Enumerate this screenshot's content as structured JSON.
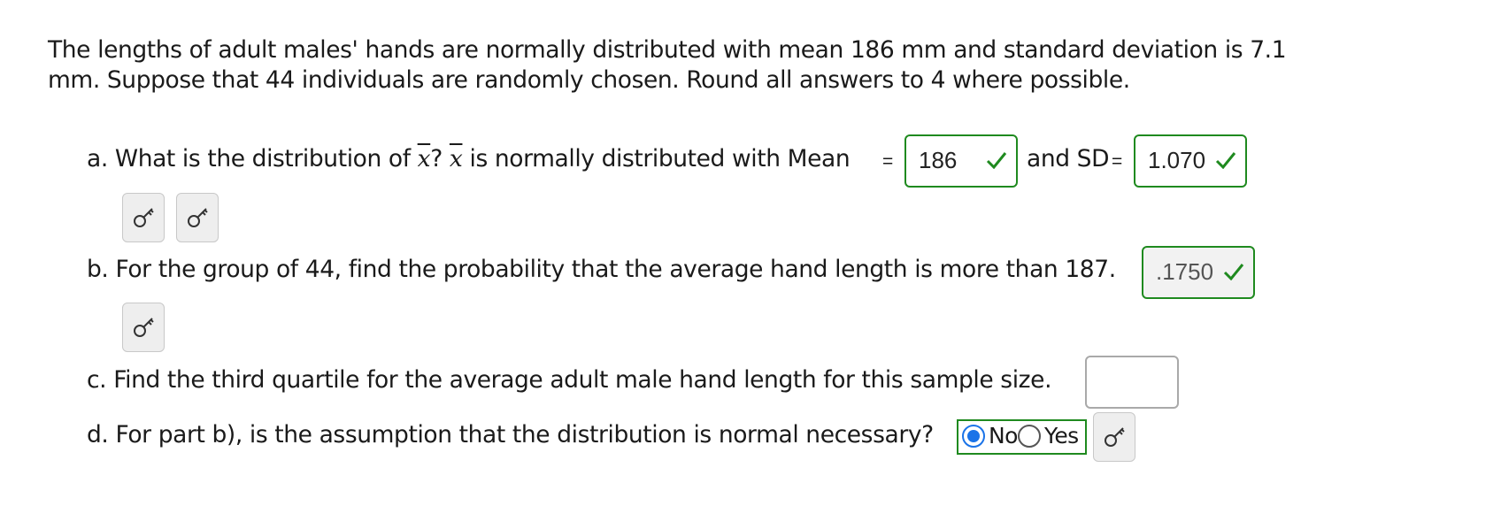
{
  "intro": {
    "line1": "The lengths of adult males' hands are normally distributed with mean 186 mm and standard deviation is 7.1",
    "line2": "mm. Suppose that 44 individuals are randomly chosen. Round all answers to 4 where possible."
  },
  "part_a": {
    "prefix": "a. What is the distribution of ",
    "xbar": "x",
    "mid": "? ",
    "xbar2": "x",
    "suffix": " is normally distributed with Mean",
    "eq1": "=",
    "mean_value": "186",
    "and_sd": "and SD",
    "eq2": "=",
    "sd_value": "1.070"
  },
  "part_b": {
    "text": "b. For the group of 44, find the probability that the average hand length is more than 187.",
    "value": ".1750"
  },
  "part_c": {
    "text": "c. Find the third quartile for the average adult male hand length for this sample size.",
    "value": ""
  },
  "part_d": {
    "text": "d. For part b), is the assumption that the distribution is normal necessary?",
    "options": [
      {
        "label": "No",
        "selected": true
      },
      {
        "label": "Yes",
        "selected": false
      }
    ]
  },
  "icons": {
    "key": "key-icon",
    "check": "checkmark-icon"
  },
  "colors": {
    "correct_border": "#1f8a1f",
    "radio_selected": "#1a73e8"
  }
}
